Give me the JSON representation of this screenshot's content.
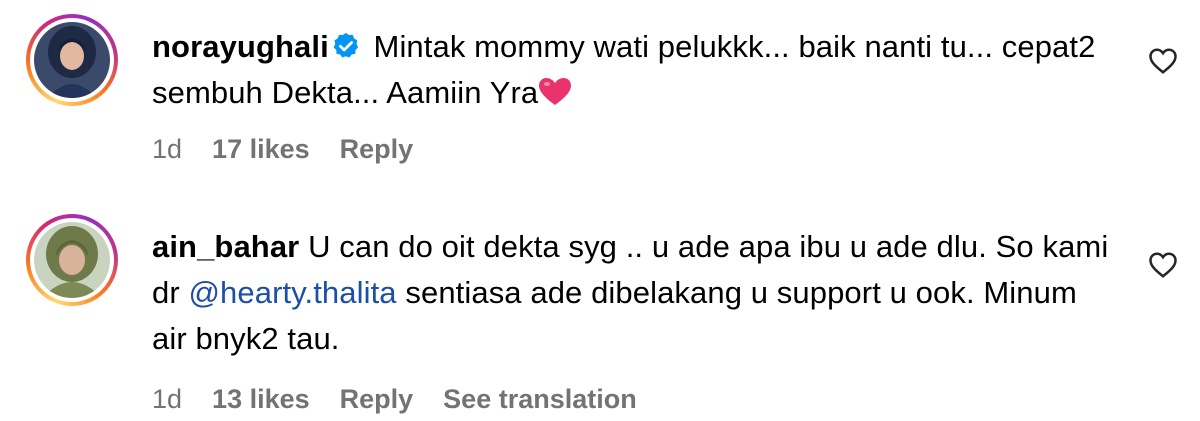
{
  "comments": [
    {
      "username": "norayughali",
      "verified": true,
      "text": "Mintak mommy wati pelukkk... baik nanti tu... cepat2 sembuh Dekta... Aamiin Yra",
      "emoji": "heart",
      "time": "1d",
      "likes": "17 likes",
      "reply": "Reply"
    },
    {
      "username": "ain_bahar",
      "verified": false,
      "text_before": "U can do oit dekta syg .. u ade apa ibu u ade dlu. So kami dr",
      "mention": "@hearty.thalita",
      "text_after": "sentiasa ade dibelakang u support u ook. Minum air bnyk2 tau.",
      "time": "1d",
      "likes": "13 likes",
      "reply": "Reply",
      "translation": "See translation"
    }
  ],
  "colors": {
    "mention": "#1c4fa5",
    "meta": "#737373",
    "verified": "#0095f6",
    "heart_emoji": "#e8336d"
  },
  "icons": {
    "like": "heart-outline-icon",
    "verified": "verified-badge-icon"
  }
}
